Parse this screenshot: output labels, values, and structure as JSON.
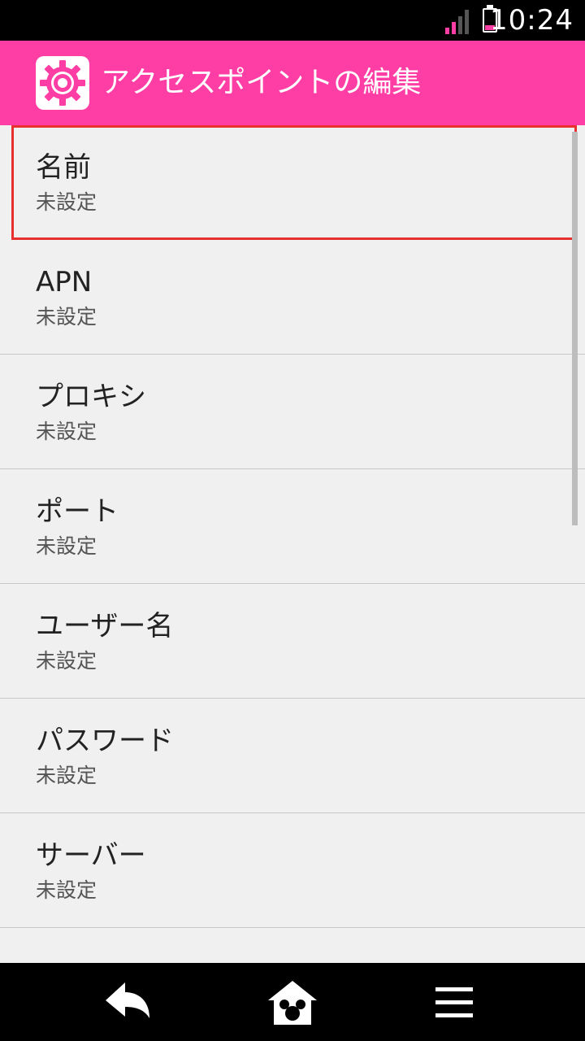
{
  "status_bar": {
    "time": "10:24",
    "signal_icon": "signal-icon",
    "battery_icon": "battery-icon",
    "signal_color": "#ff3ea5",
    "battery_level": 0.25
  },
  "app_bar": {
    "icon": "settings-gear-icon",
    "title": "アクセスポイントの編集",
    "color": "#ff3ea5"
  },
  "list": {
    "items": [
      {
        "title": "名前",
        "value": "未設定",
        "selected": true
      },
      {
        "title": "APN",
        "value": "未設定"
      },
      {
        "title": "プロキシ",
        "value": "未設定"
      },
      {
        "title": "ポート",
        "value": "未設定"
      },
      {
        "title": "ユーザー名",
        "value": "未設定"
      },
      {
        "title": "パスワード",
        "value": "未設定"
      },
      {
        "title": "サーバー",
        "value": "未設定"
      }
    ],
    "highlight_color": "#e8302f"
  },
  "nav_bar": {
    "back_icon": "back-arrow-icon",
    "home_icon": "home-icon",
    "menu_icon": "menu-icon"
  }
}
